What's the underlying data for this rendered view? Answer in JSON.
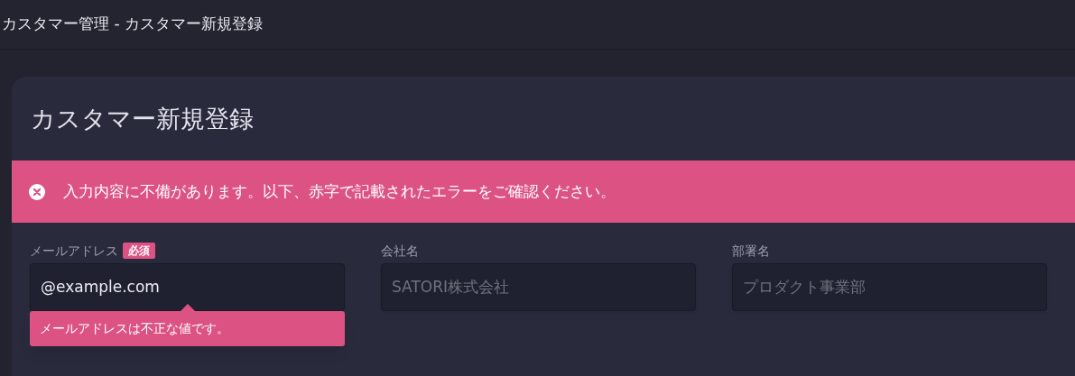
{
  "header": {
    "title": "カスタマー管理 - カスタマー新規登録"
  },
  "card": {
    "title": "カスタマー新規登録"
  },
  "alert": {
    "message": "入力内容に不備があります。以下、赤字で記載されたエラーをご確認ください。"
  },
  "fields": [
    {
      "label": "メールアドレス",
      "required_badge": "必須",
      "value": "@example.com",
      "error": "メールアドレスは不正な値です。"
    },
    {
      "label": "会社名",
      "placeholder": "SATORI株式会社"
    },
    {
      "label": "部署名",
      "placeholder": "プロダクト事業部"
    }
  ]
}
